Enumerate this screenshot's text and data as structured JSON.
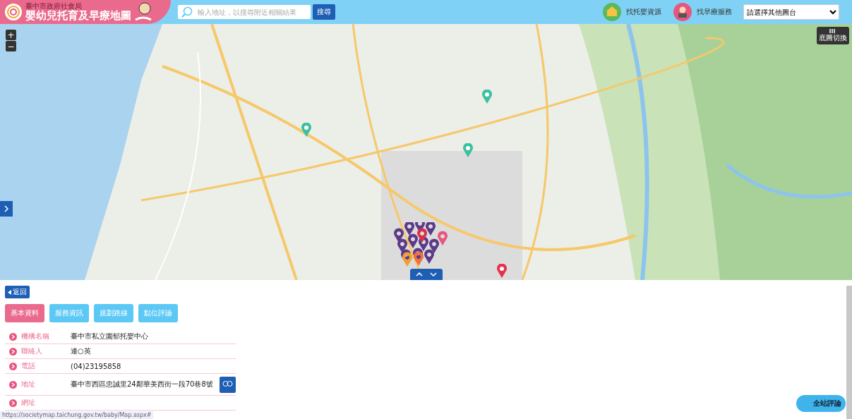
{
  "header": {
    "agency": "臺中市政府社會局",
    "title": "嬰幼兒托育及早療地圖",
    "search": {
      "placeholder": "輸入地址，以搜尋附近相關結果",
      "button": "搜尋"
    },
    "nav": [
      {
        "label": "找托嬰資源",
        "color": "#5cb85c"
      },
      {
        "label": "找早療服務",
        "color": "#e8567f"
      }
    ],
    "select": "請選擇其他圖台"
  },
  "map": {
    "zoom_in": "+",
    "zoom_out": "−",
    "layer_button": "底圖切換"
  },
  "panel": {
    "back": "返回",
    "tabs": [
      {
        "label": "基本資料",
        "selected": true
      },
      {
        "label": "服務資訊",
        "selected": false
      },
      {
        "label": "規劃路線",
        "selected": false
      },
      {
        "label": "點位評論",
        "selected": false
      }
    ],
    "rows": [
      {
        "label": "機構名稱",
        "value": "臺中市私立園郁托嬰中心"
      },
      {
        "label": "聯絡人",
        "value": "連○英"
      },
      {
        "label": "電話",
        "value": "(04)23195858"
      },
      {
        "label": "地址",
        "value": "臺中市西區忠誠里24鄰華美西街一段70巷8號",
        "kind": "address"
      },
      {
        "label": "網址",
        "value": ""
      }
    ]
  },
  "review_button": "全站評論",
  "status_url": "https://societymap.taichung.gov.tw/baby/Map.aspx#"
}
